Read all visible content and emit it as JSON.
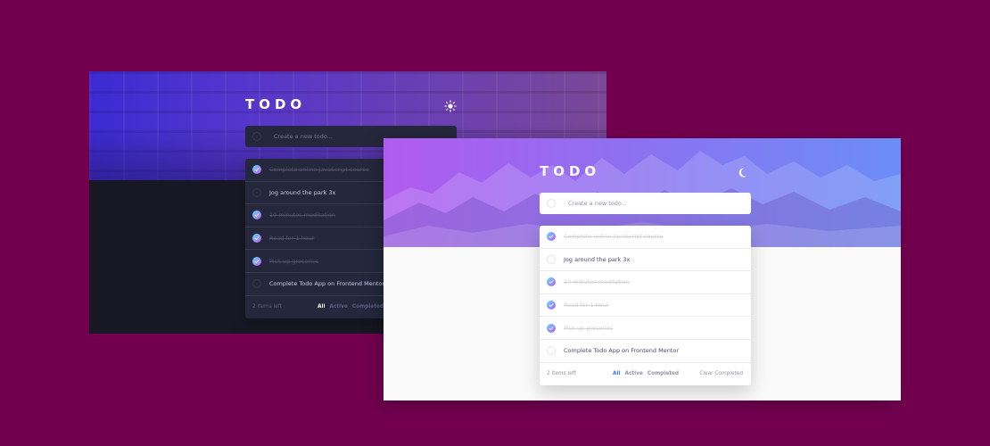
{
  "colors": {
    "background": "#72004f",
    "dark_bg": "#181824",
    "dark_card": "#25273c",
    "light_bg": "#fafafa",
    "light_card": "#ffffff",
    "check_gradient_start": "#57ddff",
    "check_gradient_end": "#c058f3",
    "active_filter_light": "#3a7cfd"
  },
  "dark": {
    "title": "TODO",
    "theme_icon": "sun-icon",
    "input_placeholder": "Create a new todo...",
    "items": [
      {
        "text": "Complete online JavaScript course",
        "completed": true
      },
      {
        "text": "Jog around the park 3x",
        "completed": false
      },
      {
        "text": "10 minutes meditation",
        "completed": true
      },
      {
        "text": "Read for 1 hour",
        "completed": true
      },
      {
        "text": "Pick up groceries",
        "completed": true
      },
      {
        "text": "Complete Todo App on Frontend Mentor",
        "completed": false
      }
    ],
    "footer": {
      "items_left": "2 items left",
      "filter_all": "All",
      "filter_active": "Active",
      "filter_completed": "Completed"
    }
  },
  "light": {
    "title": "TODO",
    "theme_icon": "moon-icon",
    "input_placeholder": "Create a new todo...",
    "items": [
      {
        "text": "Complete online JavaScript course",
        "completed": true
      },
      {
        "text": "Jog around the park 3x",
        "completed": false
      },
      {
        "text": "10 minutes meditation",
        "completed": true
      },
      {
        "text": "Read for 1 hour",
        "completed": true
      },
      {
        "text": "Pick up groceries",
        "completed": true
      },
      {
        "text": "Complete Todo App on Frontend Mentor",
        "completed": false
      }
    ],
    "footer": {
      "items_left": "2 items left",
      "filter_all": "All",
      "filter_active": "Active",
      "filter_completed": "Completed",
      "clear_completed": "Clear Completed"
    }
  }
}
